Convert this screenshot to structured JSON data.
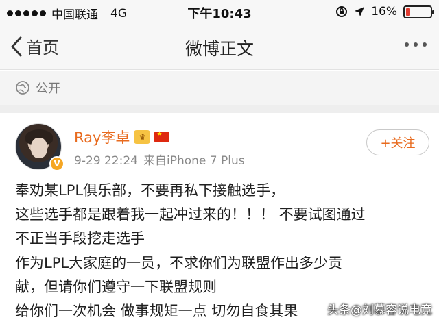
{
  "status_bar": {
    "carrier": "中国联通",
    "network": "4G",
    "time": "下午10:43",
    "battery_percent": "16%",
    "battery_level": 0.16
  },
  "nav": {
    "back_label": "首页",
    "title": "微博正文"
  },
  "privacy": {
    "label": "公开"
  },
  "post": {
    "user_name": "Ray李卓",
    "date_time": "9-29 22:24",
    "source": "来自iPhone 7 Plus",
    "follow_label": "+关注",
    "body_lines": [
      "奉劝某LPL俱乐部，不要再私下接触选手，",
      "这些选手都是跟着我一起冲过来的！！！ 不要试图通过",
      "不正当手段挖走选手",
      "作为LPL大家庭的一员，不求你们为联盟作出多少贡",
      "献，但请你们遵守一下联盟规则",
      "给你们一次机会 做事规矩一点 切勿自食其果"
    ]
  },
  "watermark": "头条@刘慕容说电竞",
  "colors": {
    "accent": "#e86b1f",
    "battery_low": "#e03c31"
  }
}
